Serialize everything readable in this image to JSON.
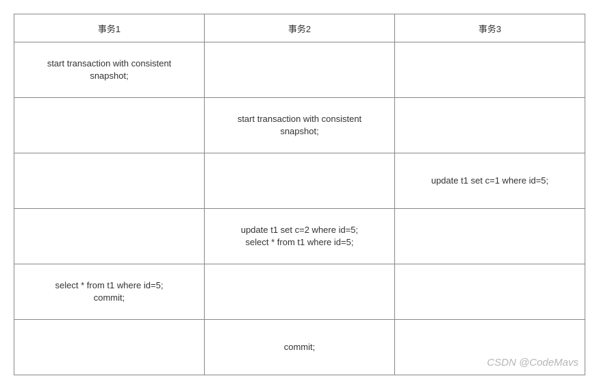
{
  "headers": [
    "事务1",
    "事务2",
    "事务3"
  ],
  "rows": [
    [
      [
        "start transaction with consistent",
        "snapshot;"
      ],
      [],
      []
    ],
    [
      [],
      [
        "start transaction with consistent",
        "snapshot;"
      ],
      []
    ],
    [
      [],
      [],
      [
        "update t1 set c=1 where id=5;"
      ]
    ],
    [
      [],
      [
        "update t1 set c=2 where id=5;",
        "select * from t1 where id=5;"
      ],
      []
    ],
    [
      [
        "select * from t1 where id=5;",
        "commit;"
      ],
      [],
      []
    ],
    [
      [],
      [
        "commit;"
      ],
      []
    ]
  ],
  "watermark": "CSDN @CodeMavs"
}
